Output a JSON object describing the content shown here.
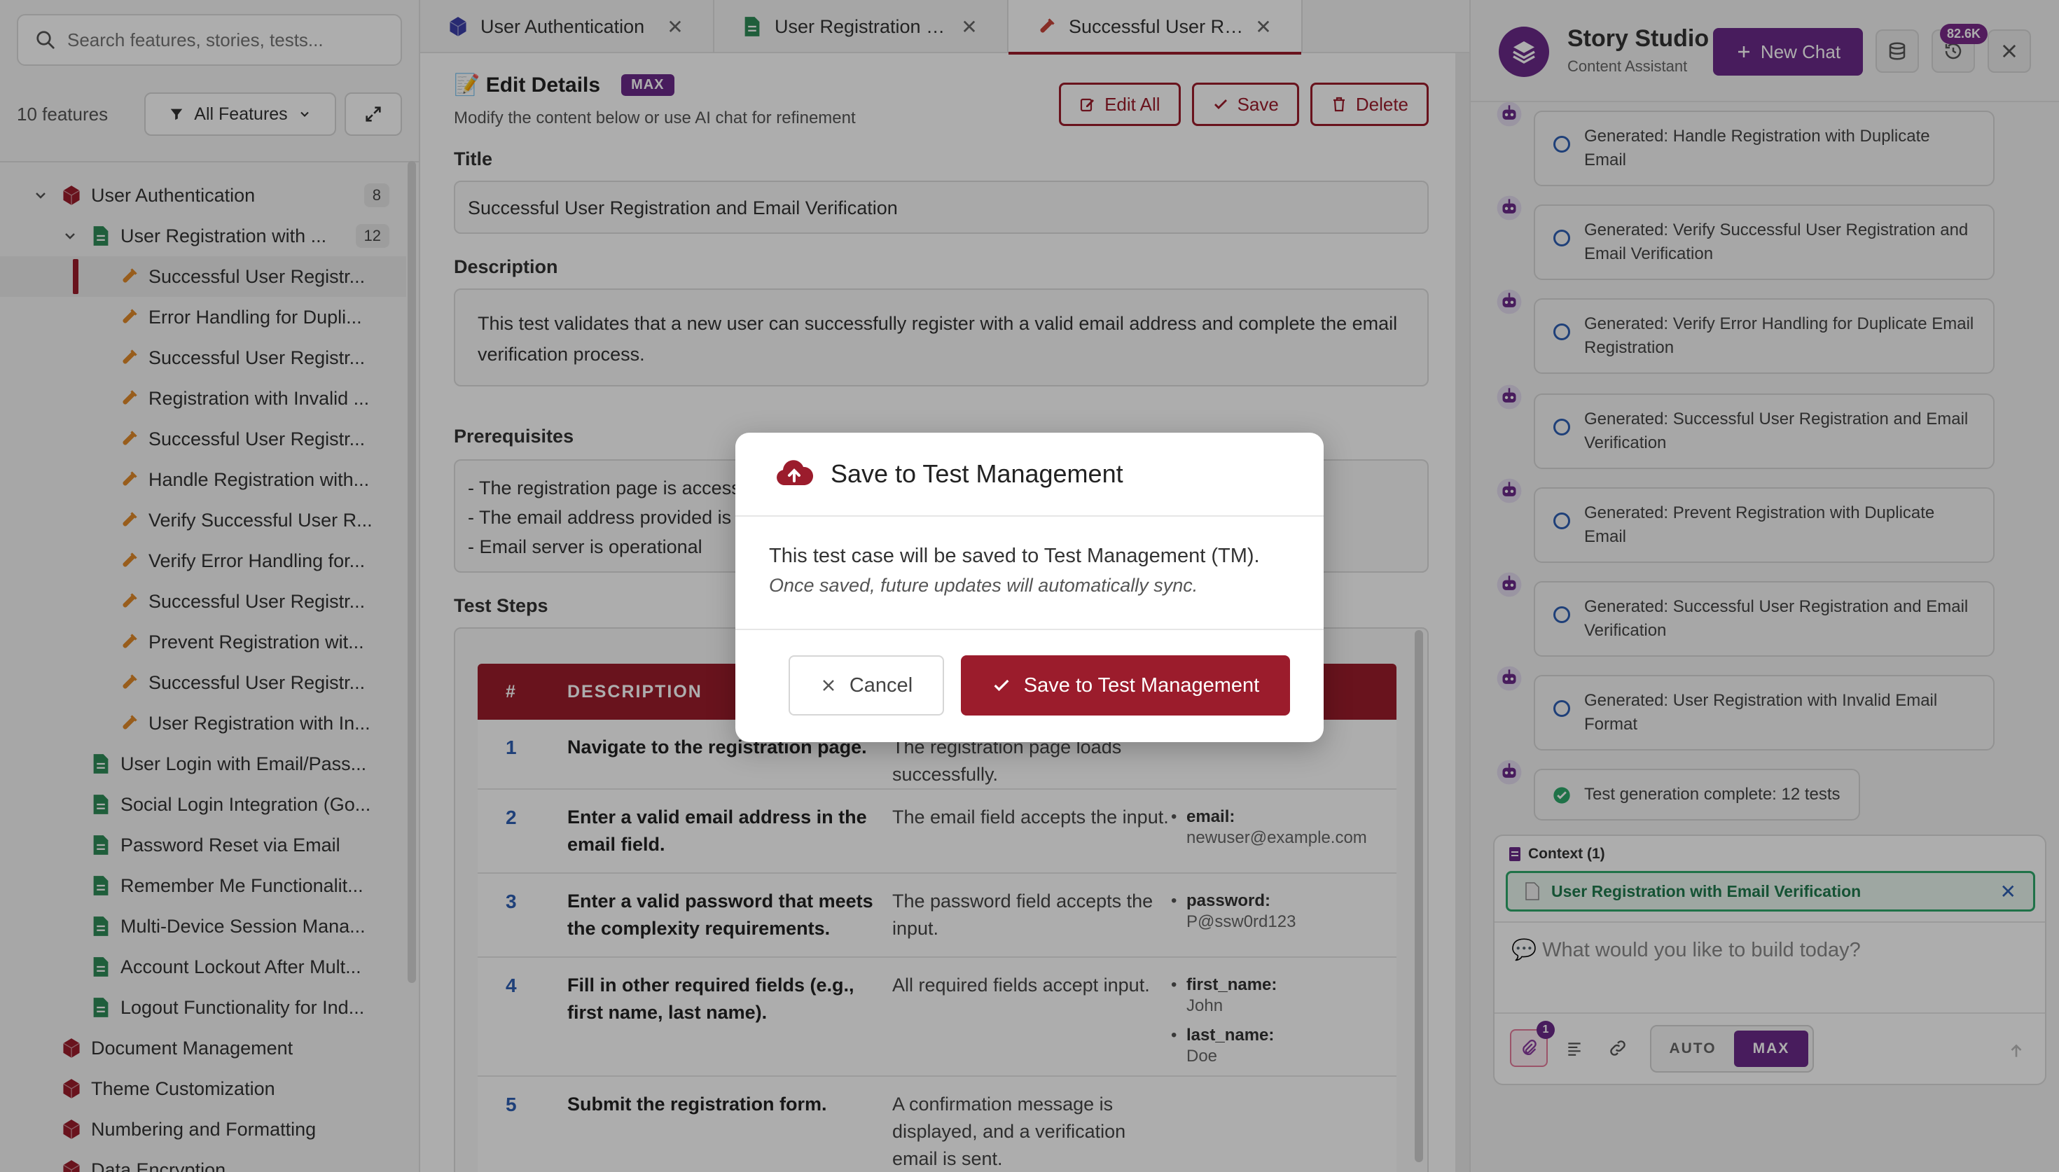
{
  "sidebar": {
    "search_placeholder": "Search features, stories, tests...",
    "count": "10 features",
    "filter_label": "All Features",
    "tree": [
      {
        "level": 0,
        "type": "feature",
        "expanded": true,
        "label": "User Authentication",
        "badge": "8"
      },
      {
        "level": 1,
        "type": "story",
        "expanded": true,
        "label": "User Registration with ...",
        "badge": "12"
      },
      {
        "level": 2,
        "type": "test",
        "label": "Successful User Registr...",
        "selected": true
      },
      {
        "level": 2,
        "type": "test",
        "label": "Error Handling for Dupli..."
      },
      {
        "level": 2,
        "type": "test",
        "label": "Successful User Registr..."
      },
      {
        "level": 2,
        "type": "test",
        "label": "Registration with Invalid ..."
      },
      {
        "level": 2,
        "type": "test",
        "label": "Successful User Registr..."
      },
      {
        "level": 2,
        "type": "test",
        "label": "Handle Registration with..."
      },
      {
        "level": 2,
        "type": "test",
        "label": "Verify Successful User R..."
      },
      {
        "level": 2,
        "type": "test",
        "label": "Verify Error Handling for..."
      },
      {
        "level": 2,
        "type": "test",
        "label": "Successful User Registr..."
      },
      {
        "level": 2,
        "type": "test",
        "label": "Prevent Registration wit..."
      },
      {
        "level": 2,
        "type": "test",
        "label": "Successful User Registr..."
      },
      {
        "level": 2,
        "type": "test",
        "label": "User Registration with In..."
      },
      {
        "level": 1,
        "type": "story",
        "label": "User Login with Email/Pass..."
      },
      {
        "level": 1,
        "type": "story",
        "label": "Social Login Integration (Go..."
      },
      {
        "level": 1,
        "type": "story",
        "label": "Password Reset via Email"
      },
      {
        "level": 1,
        "type": "story",
        "label": "Remember Me Functionalit..."
      },
      {
        "level": 1,
        "type": "story",
        "label": "Multi-Device Session Mana..."
      },
      {
        "level": 1,
        "type": "story",
        "label": "Account Lockout After Mult..."
      },
      {
        "level": 1,
        "type": "story",
        "label": "Logout Functionality for Ind..."
      },
      {
        "level": 0,
        "type": "feature",
        "label": "Document Management"
      },
      {
        "level": 0,
        "type": "feature",
        "label": "Theme Customization"
      },
      {
        "level": 0,
        "type": "feature",
        "label": "Numbering and Formatting"
      },
      {
        "level": 0,
        "type": "feature",
        "label": "Data Encryption"
      }
    ]
  },
  "tabs": [
    {
      "label": "User Authentication",
      "icon": "feature-cube-icon",
      "active": false
    },
    {
      "label": "User Registration with E...",
      "icon": "document-icon",
      "active": false
    },
    {
      "label": "Successful User Registr...",
      "icon": "test-tube-icon",
      "active": true
    }
  ],
  "editor": {
    "title": "📝 Edit Details",
    "mode_pill": "MAX",
    "subtitle": "Modify the content below or use AI chat for refinement",
    "actions": {
      "edit_all": "Edit All",
      "save": "Save",
      "delete": "Delete"
    },
    "title_label": "Title",
    "title_value": "Successful User Registration and Email Verification",
    "description_label": "Description",
    "description_value": "This test validates that a new user can successfully register with a valid email address and complete the email verification process.",
    "prerequisites_label": "Prerequisites",
    "prerequisites_lines": [
      "- The registration page is accessible",
      "- The email address provided is",
      "- Email server is operational"
    ],
    "steps_label": "Test Steps",
    "steps_headers": {
      "num": "#",
      "description": "DESCRIPTION"
    },
    "steps": [
      {
        "num": "1",
        "description": "Navigate to the registration page.",
        "expected": "The registration page loads successfully.",
        "data": []
      },
      {
        "num": "2",
        "description": "Enter a valid email address in the email field.",
        "expected": "The email field accepts the input.",
        "data": [
          {
            "key": "email:",
            "value": "newuser@example.com"
          }
        ]
      },
      {
        "num": "3",
        "description": "Enter a valid password that meets the complexity requirements.",
        "expected": "The password field accepts the input.",
        "data": [
          {
            "key": "password:",
            "value": "P@ssw0rd123"
          }
        ]
      },
      {
        "num": "4",
        "description": "Fill in other required fields (e.g., first name, last name).",
        "expected": "All required fields accept input.",
        "data": [
          {
            "key": "first_name:",
            "value": "John"
          },
          {
            "key": "last_name:",
            "value": "Doe"
          }
        ]
      },
      {
        "num": "5",
        "description": "Submit the registration form.",
        "expected": "A confirmation message is displayed, and a verification email is sent.",
        "data": []
      }
    ]
  },
  "chat": {
    "title": "Story Studio",
    "subtitle": "Content Assistant",
    "new_chat": "New Chat",
    "token_badge": "82.6K",
    "messages": [
      "Generated: Handle Registration with Duplicate Email",
      "Generated: Verify Successful User Registration and Email Verification",
      "Generated: Verify Error Handling for Duplicate Email Registration",
      "Generated: Successful User Registration and Email Verification",
      "Generated: Prevent Registration with Duplicate Email",
      "Generated: Successful User Registration and Email Verification",
      "Generated: User Registration with Invalid Email Format"
    ],
    "complete_message": "Test generation complete: 12 tests",
    "context_label": "Context (1)",
    "context_chip": "User Registration with Email Verification",
    "prompt_placeholder": "💬 What would you like to build today?",
    "attach_count": "1",
    "mode_auto": "AUTO",
    "mode_max": "MAX"
  },
  "modal": {
    "title": "Save to Test Management",
    "line1": "This test case will be saved to Test Management (TM).",
    "line2": "Once saved, future updates will automatically sync.",
    "cancel": "Cancel",
    "confirm": "Save to Test Management"
  },
  "colors": {
    "accent": "#9b1c2c",
    "brand": "#6b2a8a",
    "link": "#2f5fb3",
    "success": "#2ea86b"
  }
}
